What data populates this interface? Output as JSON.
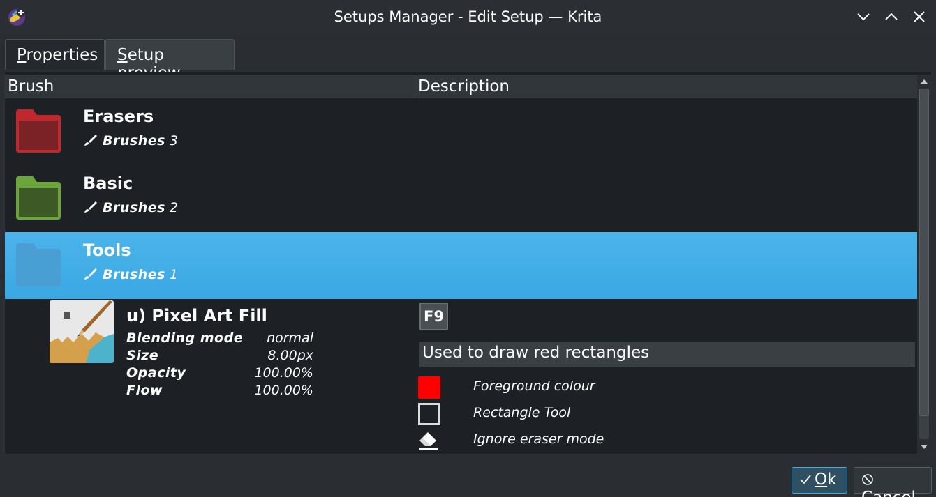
{
  "window": {
    "title": "Setups Manager - Edit Setup — Krita",
    "app_icon": "krita-icon",
    "controls": [
      "minimize-icon",
      "maximize-icon",
      "close-icon"
    ]
  },
  "tabs": [
    {
      "label_first": "P",
      "label_rest": "roperties",
      "active": false
    },
    {
      "label_first": "S",
      "label_rest": "etup preview",
      "active": true
    }
  ],
  "tree": {
    "columns": {
      "brush": "Brush",
      "description": "Description"
    },
    "groups": [
      {
        "name": "Erasers",
        "sub_label": "Brushes",
        "count": "3",
        "folder_color": "#b2262b",
        "selected": false
      },
      {
        "name": "Basic",
        "sub_label": "Brushes",
        "count": "2",
        "folder_color": "#5a8f2a",
        "selected": false
      },
      {
        "name": "Tools",
        "sub_label": "Brushes",
        "count": "1",
        "folder_color": "#4fa3d6",
        "selected": true
      }
    ],
    "preset": {
      "name": "u) Pixel Art Fill",
      "properties": [
        {
          "key": "Blending mode",
          "value": "normal"
        },
        {
          "key": "Size",
          "value": "8.00px"
        },
        {
          "key": "Opacity",
          "value": "100.00%"
        },
        {
          "key": "Flow",
          "value": "100.00%"
        }
      ],
      "shortcut": "F9",
      "description": "Used to draw red rectangles",
      "options": [
        {
          "label": "Foreground colour",
          "icon": "red-color-swatch",
          "color": "#ff0000"
        },
        {
          "label": "Rectangle Tool",
          "icon": "rectangle-tool-icon"
        },
        {
          "label": "Ignore eraser mode",
          "icon": "eraser-icon"
        }
      ]
    }
  },
  "buttons": {
    "ok_first": "O",
    "ok_rest": "k",
    "cancel_first": "C",
    "cancel_rest": "ancel"
  },
  "colors": {
    "accent": "#3daee9",
    "background": "#2a2e32"
  }
}
